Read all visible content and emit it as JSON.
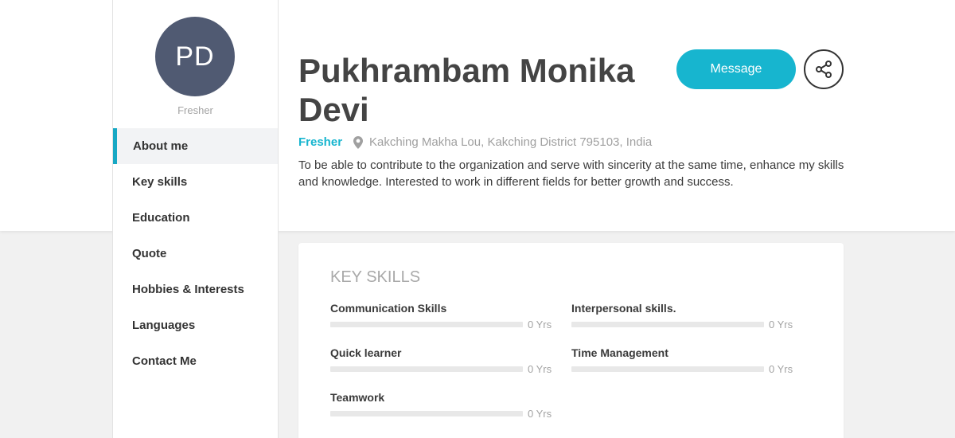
{
  "profile": {
    "initials": "PD",
    "status": "Fresher",
    "name": "Pukhrambam Monika Devi",
    "location": "Kakching Makha Lou, Kakching District 795103, India",
    "bio": "To be able to contribute to the organization and serve with sincerity at the same time, enhance my skills and knowledge. Interested to work in different fields for better growth and success.",
    "avatar_color": "#505a72"
  },
  "nav": {
    "items": [
      {
        "label": "About me",
        "active": true
      },
      {
        "label": "Key skills"
      },
      {
        "label": "Education"
      },
      {
        "label": "Quote"
      },
      {
        "label": "Hobbies & Interests"
      },
      {
        "label": "Languages"
      },
      {
        "label": "Contact Me"
      }
    ]
  },
  "actions": {
    "message_label": "Message",
    "share_icon": "share-icon"
  },
  "skills": {
    "title": "KEY SKILLS",
    "items": [
      {
        "name": "Communication Skills",
        "years": "0 Yrs",
        "level": 0
      },
      {
        "name": "Interpersonal skills.",
        "years": "0 Yrs",
        "level": 0
      },
      {
        "name": "Quick learner",
        "years": "0 Yrs",
        "level": 0
      },
      {
        "name": "Time Management",
        "years": "0 Yrs",
        "level": 0
      },
      {
        "name": "Teamwork",
        "years": "0 Yrs",
        "level": 0
      }
    ]
  },
  "colors": {
    "accent": "#17b5cf",
    "active_border": "#17a8c4",
    "bar_track": "#e8e8e8"
  }
}
